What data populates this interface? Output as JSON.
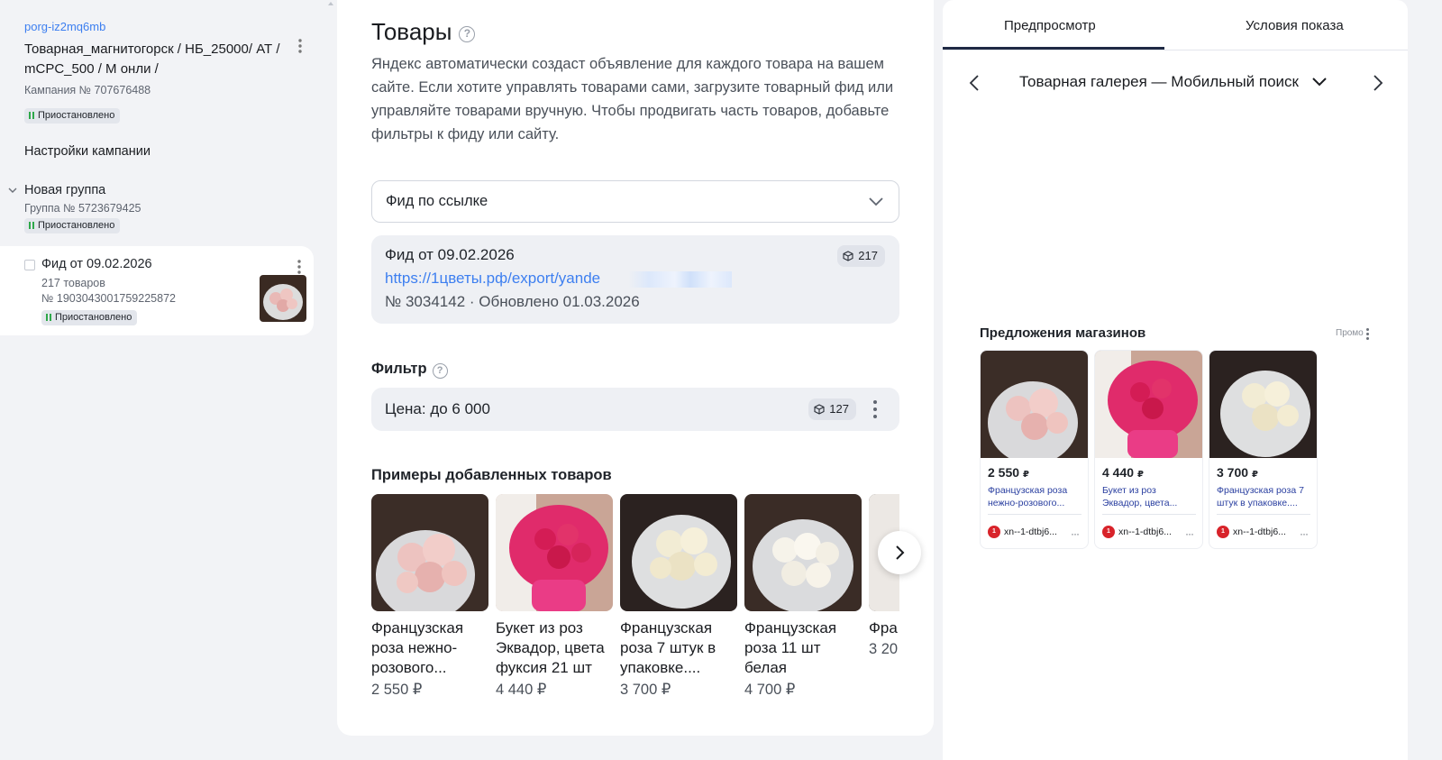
{
  "sidebar": {
    "campaign": {
      "login": "porg-iz2mq6mb",
      "name": "Товарная_магнитогорск / НБ_25000/ АТ / mCPC_500 / М онли /",
      "number": "Кампания № 707676488",
      "status": "Приостановлено"
    },
    "settings_label": "Настройки кампании",
    "group": {
      "title": "Новая группа",
      "number": "Группа № 5723679425",
      "status": "Приостановлено"
    },
    "feed_item": {
      "title": "Фид от 09.02.2026",
      "count": "217 товаров",
      "number": "№ 1903043001759225872",
      "status": "Приостановлено"
    }
  },
  "main": {
    "title": "Товары",
    "help": "?",
    "description": "Яндекс автоматически создаст объявление для каждого товара на вашем сайте. Если хотите управлять товарами сами, загрузите товарный фид или управляйте товарами вручную. Чтобы продвигать часть товаров, добавьте фильтры к фиду или сайту.",
    "source_select": "Фид по ссылке",
    "feed": {
      "title": "Фид от 09.02.2026",
      "url": "https://1цветы.рф/export/yande",
      "meta": "№ 3034142 · Обновлено 01.03.2026",
      "count": "217"
    },
    "filter": {
      "heading": "Фильтр",
      "label": "Цена: до 6 000",
      "count": "127"
    },
    "examples_heading": "Примеры добавленных товаров",
    "examples": [
      {
        "name": "Французская роза нежно-розового...",
        "price": "2 550 ₽"
      },
      {
        "name": "Букет из роз Эквадор, цвета фуксия 21 шт",
        "price": "4 440 ₽"
      },
      {
        "name": "Французская роза 7 штук в упаковке....",
        "price": "3 700 ₽"
      },
      {
        "name": "Французская роза 11 шт белая",
        "price": "4 700 ₽"
      },
      {
        "name": "Фра розы «Ни",
        "price": "3 20"
      }
    ]
  },
  "preview": {
    "tabs": [
      "Предпросмотр",
      "Условия показа"
    ],
    "format": "Товарная галерея — Мобильный поиск",
    "offers_heading": "Предложения магазинов",
    "promo": "Промо",
    "offers": [
      {
        "price": "2 550",
        "currency": "₽",
        "name": "Французская роза нежно-розового...",
        "shop": "xn--1-dtbj6..."
      },
      {
        "price": "4 440",
        "currency": "₽",
        "name": "Букет из роз Эквадор, цвета...",
        "shop": "xn--1-dtbj6..."
      },
      {
        "price": "3 700",
        "currency": "₽",
        "name": "Французская роза 7 штук в упаковке....",
        "shop": "xn--1-dtbj6..."
      }
    ]
  },
  "colors": {
    "accent": "#3d7ff0",
    "status_green": "#2ea84a",
    "shop_red": "#d8232a"
  }
}
